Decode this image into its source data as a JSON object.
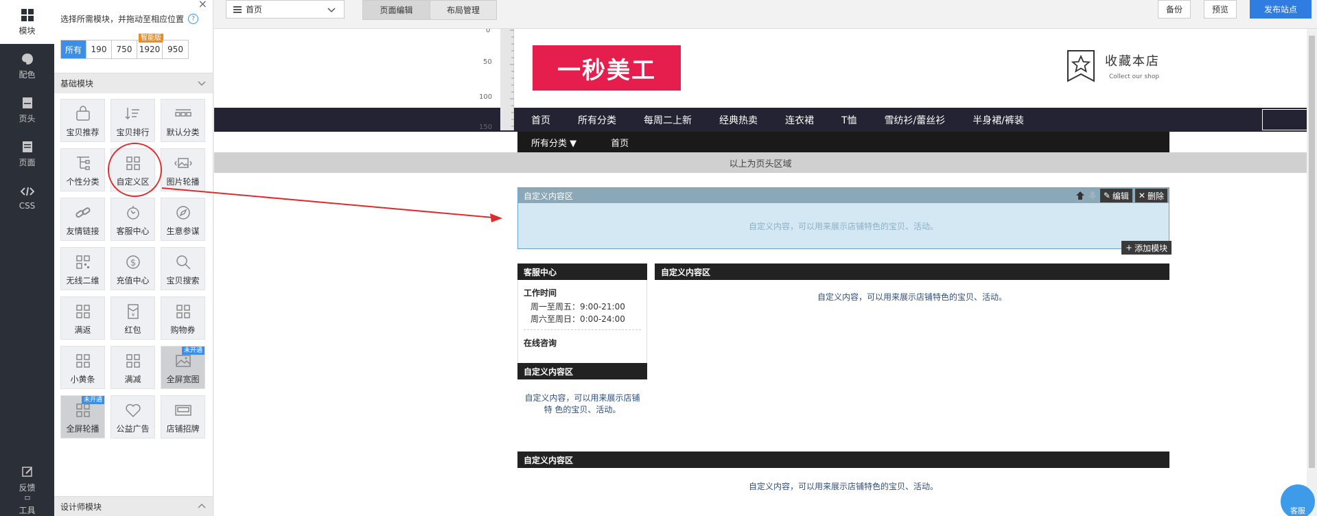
{
  "leftnav": {
    "items": [
      {
        "label": "模块",
        "icon": "grid-icon"
      },
      {
        "label": "配色",
        "icon": "palette-icon"
      },
      {
        "label": "页头",
        "icon": "header-icon"
      },
      {
        "label": "页面",
        "icon": "page-icon"
      },
      {
        "label": "CSS",
        "icon": "code-icon"
      }
    ],
    "bottom": [
      {
        "label": "反馈",
        "icon": "edit-icon"
      },
      {
        "label": "工具",
        "icon": "tool-icon"
      }
    ]
  },
  "panel": {
    "hint": "选择所需模块，并拖动至相应位置",
    "help": "?",
    "close": "×",
    "tabs": [
      {
        "label": "所有",
        "active": true
      },
      {
        "label": "190"
      },
      {
        "label": "750"
      },
      {
        "label": "1920",
        "tag": "智能版"
      },
      {
        "label": "950"
      }
    ],
    "section_basic": "基础模块",
    "section_designer": "设计师模块",
    "modules": [
      {
        "label": "宝贝推荐",
        "icon": "bag-icon"
      },
      {
        "label": "宝贝排行",
        "icon": "sort-icon"
      },
      {
        "label": "默认分类",
        "icon": "category-icon"
      },
      {
        "label": "个性分类",
        "icon": "tree-icon"
      },
      {
        "label": "自定义区",
        "icon": "custom-grid-icon"
      },
      {
        "label": "图片轮播",
        "icon": "carousel-icon"
      },
      {
        "label": "友情链接",
        "icon": "link-icon"
      },
      {
        "label": "客服中心",
        "icon": "service-icon"
      },
      {
        "label": "生意参谋",
        "icon": "compass-icon"
      },
      {
        "label": "无线二维",
        "icon": "qrcode-icon"
      },
      {
        "label": "充值中心",
        "icon": "dollar-icon"
      },
      {
        "label": "宝贝搜索",
        "icon": "search-icon"
      },
      {
        "label": "满返",
        "icon": "grid-icon"
      },
      {
        "label": "红包",
        "icon": "redpacket-icon"
      },
      {
        "label": "购物券",
        "icon": "grid-icon"
      },
      {
        "label": "小黄条",
        "icon": "grid-icon"
      },
      {
        "label": "满减",
        "icon": "grid-icon"
      },
      {
        "label": "全屏宽图",
        "icon": "image-icon",
        "badge": "未开通"
      },
      {
        "label": "全屏轮播",
        "icon": "grid-icon",
        "badge": "未开通"
      },
      {
        "label": "公益广告",
        "icon": "heart-icon"
      },
      {
        "label": "店铺招牌",
        "icon": "signboard-icon"
      }
    ]
  },
  "topbar": {
    "page_select": "首页",
    "seg": [
      "页面编辑",
      "布局管理"
    ],
    "backup": "备份",
    "preview": "预览",
    "publish": "发布站点"
  },
  "ruler": [
    "0",
    "50",
    "100",
    "150"
  ],
  "shop": {
    "logo": "一秒美工",
    "fav_title": "收藏本店",
    "fav_sub": "Collect our shop",
    "nav": [
      "首页",
      "所有分类",
      "每周二上新",
      "经典热卖",
      "连衣裙",
      "T恤",
      "雪纺衫/蕾丝衫",
      "半身裙/裤装"
    ],
    "subnav_all": "所有分类 ▼",
    "subnav_home": "首页",
    "header_area": "以上为页头区域"
  },
  "selected": {
    "title": "自定义内容区",
    "edit": "编辑",
    "delete": "删除",
    "body": "自定义内容，可以用来展示店铺特色的宝贝、活动。",
    "add": "添加模块"
  },
  "service": {
    "title": "客服中心",
    "work_time": "工作时间",
    "line1": "周一至周五：9:00-21:00",
    "line2": "周六至周日：0:00-24:00",
    "online": "在线咨询"
  },
  "custom_right": {
    "title": "自定义内容区",
    "body": "自定义内容，可以用来展示店铺特色的宝贝、活动。"
  },
  "custom_left": {
    "title": "自定义内容区",
    "body": "自定义内容，可以用来展示店铺特 色的宝贝、活动。"
  },
  "custom_bottom": {
    "title": "自定义内容区",
    "body": "自定义内容，可以用来展示店铺特色的宝贝、活动。"
  },
  "kefu": "客服",
  "colors": {
    "nav_dark": "#2b2f37",
    "accent_blue": "#3b8fe8",
    "logo_red": "#e51e4d",
    "annotation_red": "#e12b2b"
  }
}
